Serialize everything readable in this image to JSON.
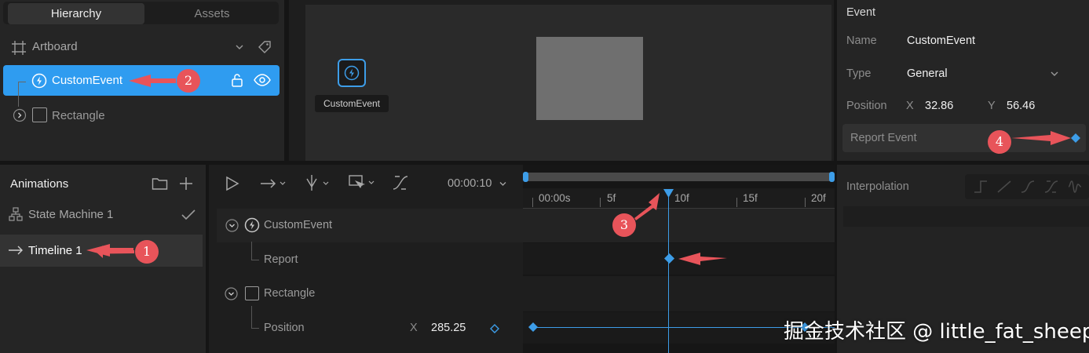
{
  "hierarchy": {
    "tabs": [
      "Hierarchy",
      "Assets"
    ],
    "artboard_label": "Artboard",
    "items": [
      {
        "label": "CustomEvent",
        "icon": "lightning-icon"
      },
      {
        "label": "Rectangle",
        "icon": "rectangle-icon"
      }
    ]
  },
  "stage": {
    "event_label": "CustomEvent"
  },
  "inspector": {
    "section": "Event",
    "name_label": "Name",
    "name_value": "CustomEvent",
    "type_label": "Type",
    "type_value": "General",
    "position_label": "Position",
    "x_label": "X",
    "x_value": "32.86",
    "y_label": "Y",
    "y_value": "56.46",
    "report_label": "Report Event"
  },
  "animations": {
    "title": "Animations",
    "items": [
      {
        "label": "State Machine 1"
      },
      {
        "label": "Timeline 1"
      }
    ]
  },
  "timeline": {
    "time": "00:00:10",
    "ruler": [
      "00:00s",
      "5f",
      "10f",
      "15f",
      "20f"
    ],
    "rows": [
      {
        "label": "CustomEvent"
      },
      {
        "label": "Report"
      },
      {
        "label": "Rectangle"
      },
      {
        "label": "Position",
        "axis": "X",
        "value": "285.25"
      }
    ]
  },
  "interpolation": {
    "title": "Interpolation"
  },
  "annotations": [
    "1",
    "2",
    "3",
    "4"
  ],
  "watermark": "掘金技术社区 @ little_fat_sheep",
  "colors": {
    "accent": "#2f9cf0",
    "keyframe": "#3d9de8",
    "annotation": "#e8545a"
  }
}
